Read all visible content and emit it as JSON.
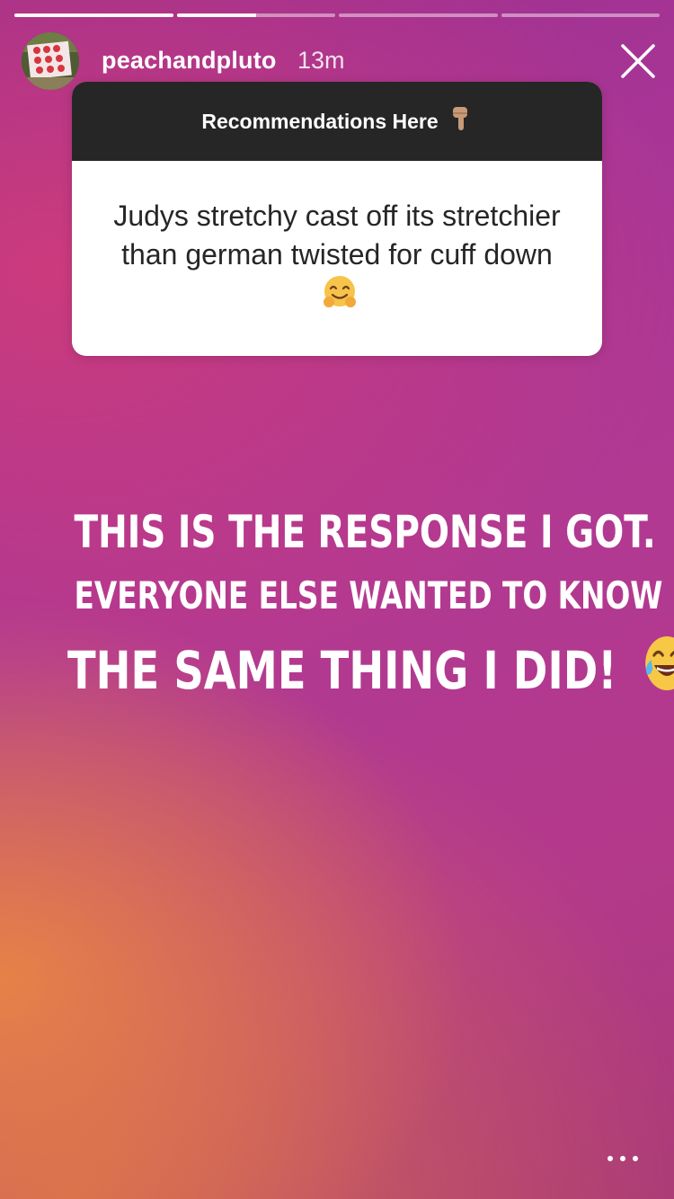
{
  "story": {
    "progress": [
      1,
      0.5,
      0,
      0
    ],
    "username": "peachandpluto",
    "time": "13m",
    "avatar_icon": "avatar-image"
  },
  "question_card": {
    "header": "Recommendations Here",
    "header_icon": "pointing-down-hand-icon",
    "answer_part1": "Judys stretchy cast off its stretchier than german twisted for cuff down",
    "answer_icon": "hugging-face-icon"
  },
  "caption": {
    "line1": "THIS IS THE RESPONSE I GOT.",
    "line2": "EVERYONE ELSE WANTED TO KNOW",
    "line3": "THE SAME THING I DID!",
    "emoji": "laughing-tears-icon"
  },
  "colors": {
    "card_header": "#262626",
    "card_text": "#262626",
    "text": "#ffffff"
  },
  "icons": {
    "close": "close-icon",
    "more": "more-options-icon"
  }
}
